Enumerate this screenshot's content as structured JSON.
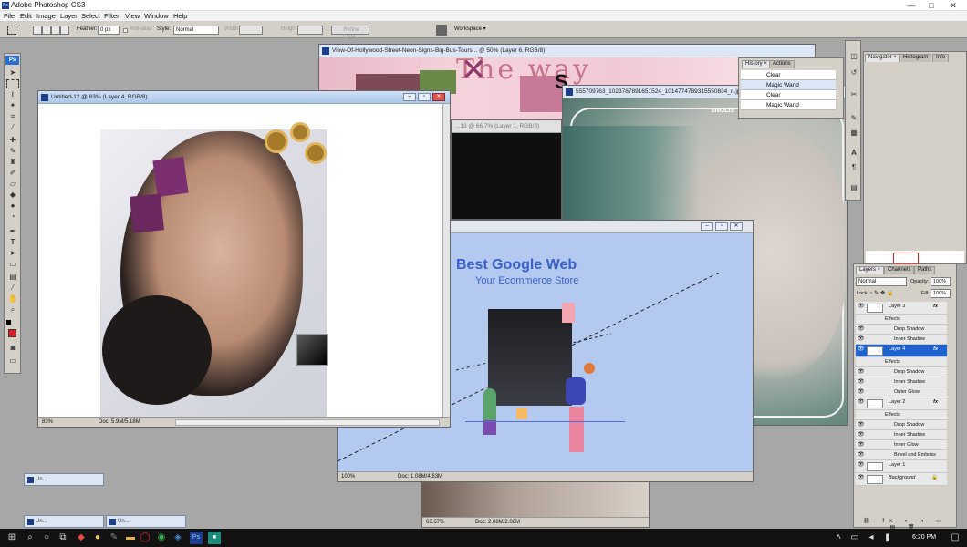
{
  "app": {
    "title": "Adobe Photoshop CS3"
  },
  "window_controls": {
    "minimize": "—",
    "maximize": "□",
    "close": "✕"
  },
  "menu": [
    "File",
    "Edit",
    "Image",
    "Layer",
    "Select",
    "Filter",
    "View",
    "Window",
    "Help"
  ],
  "options": {
    "feather_label": "Feather:",
    "feather_value": "0 px",
    "antialias_label": "Anti-alias",
    "style_label": "Style:",
    "style_value": "Normal",
    "width_label": "Width:",
    "height_label": "Height:",
    "refine_edge": "Refine Edge...",
    "workspace": "Workspace ▾"
  },
  "windows": {
    "untitled": {
      "title": "Untitled-12 @ 83% (Layer 4, RGB/8)",
      "zoom": "83%",
      "doc": "Doc: 5.9M/5.18M"
    },
    "hollywood": {
      "title": "View-Of-Hollywood-Street-Neon-Signs-Big-Bus-Tours... @ 50% (Layer 6, RGB/8)"
    },
    "middle": {
      "title": "...13 @ 66.7% (Layer 1, RGB/8)"
    },
    "portrait": {
      "title": "555709763_1023787891651524_1014774789315550834_n.jpg @ 66.7%",
      "zoom": "66.67%",
      "doc": "Doc: 2.08M/2.08M"
    },
    "google": {
      "title": "",
      "heading": "Best Google Web",
      "sub": "Your Ecommerce Store",
      "zoom": "100%",
      "doc": "Doc: 1.08M/4.63M"
    }
  },
  "canvas_text": {
    "neon": "The way",
    "s_letter": "S",
    "label": "SNOLIS"
  },
  "history": {
    "tabs": [
      "History ×",
      "Actions"
    ],
    "items": [
      "Clear",
      "Magic Wand",
      "Clear",
      "Magic Wand"
    ]
  },
  "navigator": {
    "tabs": [
      "Navigator ×",
      "Histogram",
      "Info"
    ]
  },
  "layers": {
    "tabs": [
      "Layers ×",
      "Channels",
      "Paths"
    ],
    "blend": "Normal",
    "opacity_label": "Opacity:",
    "opacity": "100%",
    "lock_label": "Lock:",
    "fill_label": "Fill:",
    "fill": "100%",
    "rows": [
      {
        "name": "Layer 3",
        "type": "layer",
        "fx": "fx"
      },
      {
        "name": "Effects",
        "type": "effects"
      },
      {
        "name": "Drop Shadow",
        "type": "effect"
      },
      {
        "name": "Inner Shadow",
        "type": "effect"
      },
      {
        "name": "Layer 4",
        "type": "layer",
        "fx": "fx",
        "selected": true
      },
      {
        "name": "Effects",
        "type": "effects"
      },
      {
        "name": "Drop Shadow",
        "type": "effect"
      },
      {
        "name": "Inner Shadow",
        "type": "effect"
      },
      {
        "name": "Outer Glow",
        "type": "effect"
      },
      {
        "name": "Layer 2",
        "type": "layer",
        "fx": "fx"
      },
      {
        "name": "Effects",
        "type": "effects"
      },
      {
        "name": "Drop Shadow",
        "type": "effect"
      },
      {
        "name": "Inner Shadow",
        "type": "effect"
      },
      {
        "name": "Inner Glow",
        "type": "effect"
      },
      {
        "name": "Bevel and Emboss",
        "type": "effect"
      },
      {
        "name": "Layer 1",
        "type": "layer"
      },
      {
        "name": "Background",
        "type": "background"
      }
    ]
  },
  "minimized": [
    "Un...",
    "Un...",
    "Un..."
  ],
  "taskbar": {
    "time": "6:20 PM"
  },
  "colors": {
    "accent": "#1e62d0",
    "ps_blue": "#1b3d8a",
    "canvas_blue": "#b3c9ef",
    "heading_blue": "#3a5fcf"
  }
}
